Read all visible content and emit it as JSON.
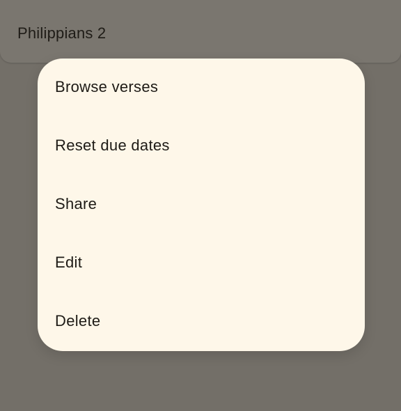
{
  "background_card": {
    "title": "Philippians 2"
  },
  "menu": {
    "items": [
      {
        "label": "Browse verses"
      },
      {
        "label": "Reset due dates"
      },
      {
        "label": "Share"
      },
      {
        "label": "Edit"
      },
      {
        "label": "Delete"
      }
    ]
  },
  "colors": {
    "scrim": "#736f68",
    "menu_surface": "#fef7e9",
    "text": "#1e1b16"
  }
}
